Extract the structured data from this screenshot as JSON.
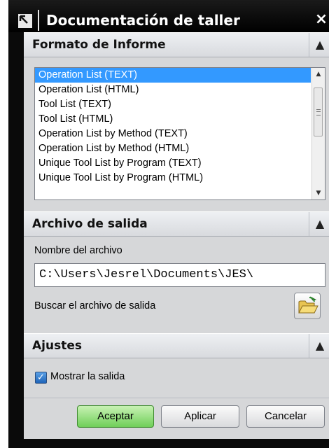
{
  "window": {
    "title": "Documentación de taller",
    "close_glyph": "×"
  },
  "format_section": {
    "title": "Formato de Informe",
    "collapse_glyph": "▲",
    "items": [
      "Operation List (TEXT)",
      "Operation List (HTML)",
      "Tool List (TEXT)",
      "Tool List (HTML)",
      "Operation List by Method (TEXT)",
      "Operation List by Method (HTML)",
      "Unique Tool List by Program (TEXT)",
      "Unique Tool List by Program (HTML)"
    ],
    "selected_index": 0,
    "scroll_up_glyph": "▲",
    "scroll_down_glyph": "▼"
  },
  "output_section": {
    "title": "Archivo de salida",
    "collapse_glyph": "▲",
    "filename_label": "Nombre del archivo",
    "filename_value": "C:\\Users\\Jesrel\\Documents\\JES\\",
    "browse_label": "Buscar el archivo de salida"
  },
  "settings_section": {
    "title": "Ajustes",
    "collapse_glyph": "▲",
    "show_output_label": "Mostrar la salida",
    "show_output_checked": true,
    "check_glyph": "✓"
  },
  "buttons": {
    "ok": "Aceptar",
    "apply": "Aplicar",
    "cancel": "Cancelar"
  },
  "icons": {
    "title_icon": "dialog-arrow-icon",
    "browse_icon": "open-folder-icon"
  }
}
